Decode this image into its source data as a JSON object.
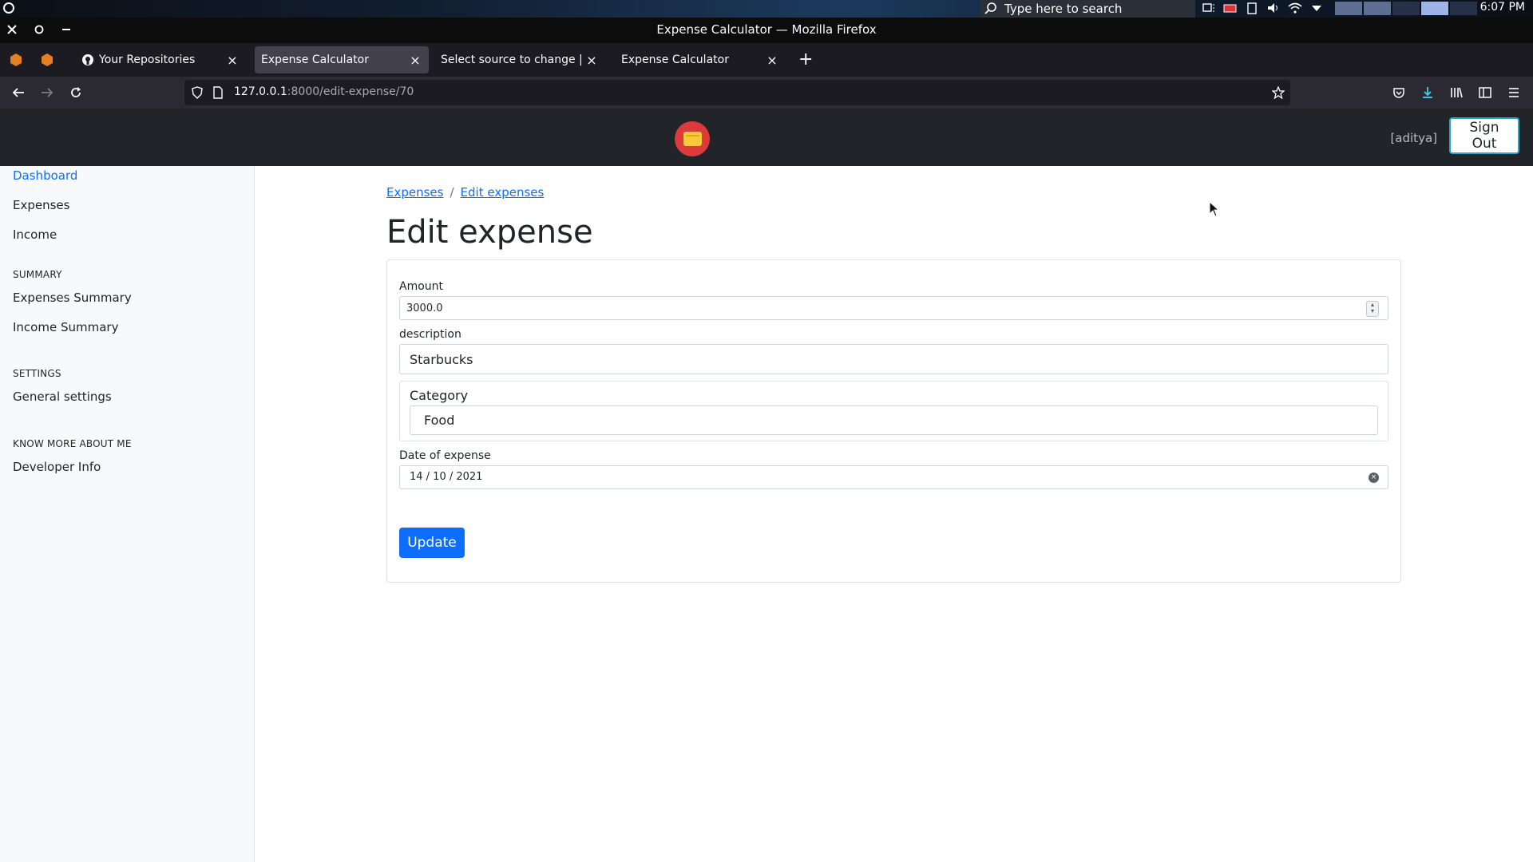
{
  "os": {
    "search_placeholder": "Type here to search",
    "clock": "6:07 PM",
    "tray_icons": [
      "screen-icon",
      "battery-icon",
      "clipboard-icon",
      "volume-icon",
      "wifi-icon",
      "dropdown-icon"
    ]
  },
  "browser": {
    "window_title": "Expense Calculator — Mozilla Firefox",
    "tabs": [
      {
        "label": "Your Repositories",
        "icon": "github-icon",
        "active": false
      },
      {
        "label": "Expense Calculator",
        "icon": "",
        "active": true
      },
      {
        "label": "Select source to change | Djan",
        "icon": "",
        "active": false
      },
      {
        "label": "Expense Calculator",
        "icon": "",
        "active": false
      }
    ],
    "url_host": "127.0.0.1",
    "url_path": ":8000/edit-expense/70"
  },
  "header": {
    "user": "[aditya]",
    "signout_label": "Sign Out"
  },
  "sidebar": {
    "items": [
      "Dashboard",
      "Expenses",
      "Income"
    ],
    "summary_heading": "SUMMARY",
    "summary_items": [
      "Expenses Summary",
      "Income Summary"
    ],
    "settings_heading": "SETTINGS",
    "settings_items": [
      "General settings"
    ],
    "about_heading": "KNOW MORE ABOUT ME",
    "about_items": [
      "Developer Info"
    ]
  },
  "main": {
    "breadcrumb": [
      "Expenses",
      "Edit expenses"
    ],
    "breadcrumb_sep": "/",
    "title": "Edit expense",
    "form": {
      "amount_label": "Amount",
      "amount_value": "3000.0",
      "description_label": "description",
      "description_value": "Starbucks",
      "category_label": "Category",
      "category_value": "Food",
      "date_label": "Date of expense",
      "date_value": "14 / 10 / 2021",
      "submit_label": "Update"
    }
  },
  "colors": {
    "accent": "#0d6efd",
    "header_bg": "#212529",
    "sidebar_bg": "#f8f9fa"
  }
}
